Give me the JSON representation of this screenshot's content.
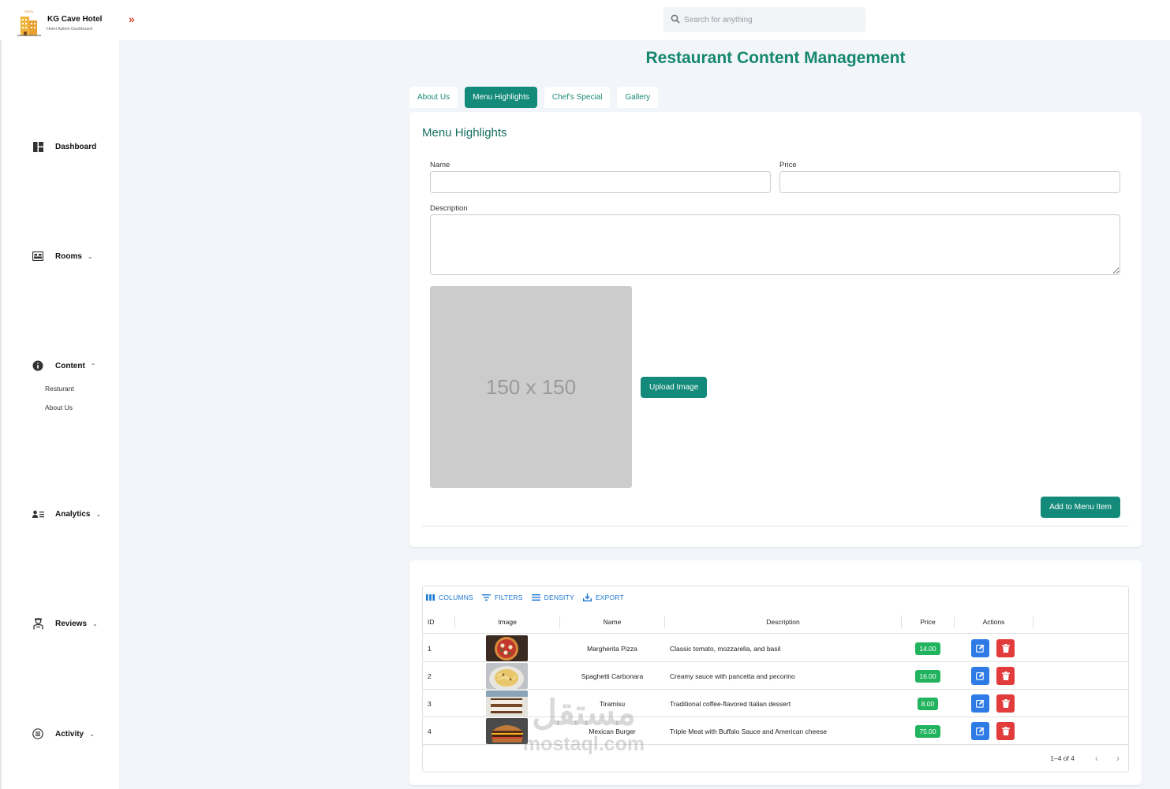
{
  "brand": {
    "title": "KG Cave Hotel",
    "subtitle": "Hotel Admin Dashboard",
    "logo_label": "HOTEL"
  },
  "search": {
    "placeholder": "Search for anything"
  },
  "sidebar": {
    "items": [
      {
        "label": "Dashboard",
        "icon": "dashboard-icon"
      },
      {
        "label": "Rooms",
        "icon": "bed-icon",
        "chevron": "down"
      },
      {
        "label": "Content",
        "icon": "info-icon",
        "chevron": "up",
        "sub": [
          "Resturant",
          "About Us"
        ]
      },
      {
        "label": "Analytics",
        "icon": "people-icon",
        "chevron": "down"
      },
      {
        "label": "Reviews",
        "icon": "person-icon",
        "chevron": "down"
      },
      {
        "label": "Activity",
        "icon": "list-circle-icon",
        "chevron": "down"
      }
    ]
  },
  "page": {
    "title": "Restaurant Content Management"
  },
  "tabs": [
    {
      "label": "About Us",
      "active": false
    },
    {
      "label": "Menu Highlights",
      "active": true
    },
    {
      "label": "Chef's Special",
      "active": false
    },
    {
      "label": "Gallery",
      "active": false
    }
  ],
  "form": {
    "section_title": "Menu Highlights",
    "name_label": "Name",
    "name_value": "",
    "price_label": "Price",
    "price_value": "",
    "description_label": "Description",
    "description_value": "",
    "image_placeholder": "150 x 150",
    "upload_label": "Upload Image",
    "add_label": "Add to Menu Item"
  },
  "grid": {
    "toolbar": [
      "COLUMNS",
      "FILTERS",
      "DENSITY",
      "EXPORT"
    ],
    "columns": [
      "ID",
      "Image",
      "Name",
      "Description",
      "Price",
      "Actions"
    ],
    "rows": [
      {
        "id": "1",
        "name": "Margherita Pizza",
        "description": "Classic tomato, mozzarella, and basil",
        "price": "14.00"
      },
      {
        "id": "2",
        "name": "Spaghetti Carbonara",
        "description": "Creamy sauce with pancetta and pecorino",
        "price": "16.00"
      },
      {
        "id": "3",
        "name": "Tiramisu",
        "description": "Traditional coffee-flavored Italian dessert",
        "price": "8.00"
      },
      {
        "id": "4",
        "name": "Mexican Burger",
        "description": "Triple Meat with Buffalo Sauce and American cheese",
        "price": "75.00"
      }
    ],
    "pagination": "1–4 of 4"
  },
  "watermark": {
    "line1": "مستقل",
    "line2": "mostaql.com"
  },
  "colors": {
    "accent": "#138a7a",
    "title": "#15876f",
    "price": "#22b35f",
    "edit": "#2f7be5",
    "delete": "#e23b3b"
  }
}
